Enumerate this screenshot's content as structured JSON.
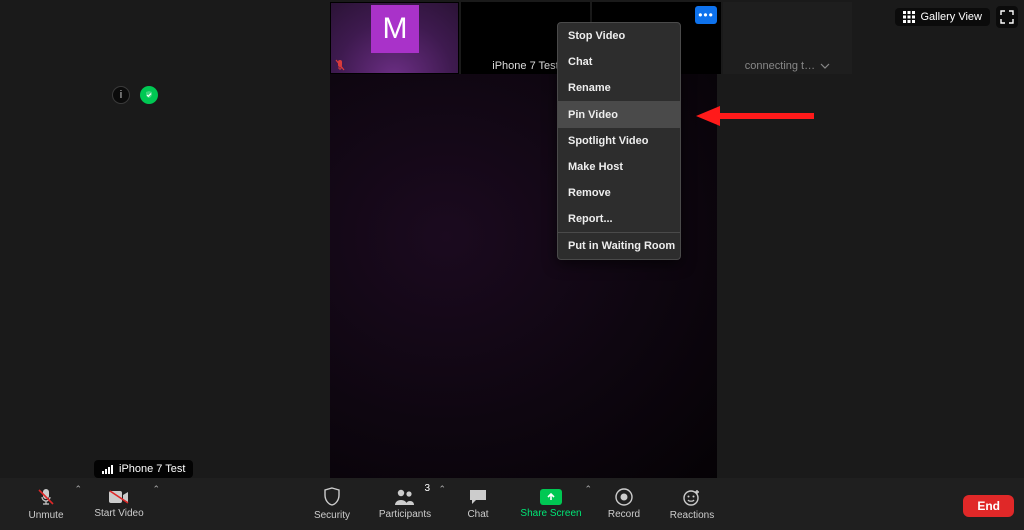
{
  "thumbnails": {
    "p1": {
      "avatar_letter": "M",
      "muted": true
    },
    "p2": {
      "label": "iPhone 7 Test"
    },
    "p3": {
      "has_more_menu": true
    },
    "p4": {
      "status": "connecting t…"
    }
  },
  "top_right": {
    "gallery_label": "Gallery View"
  },
  "context_menu": {
    "stop_video": "Stop Video",
    "chat": "Chat",
    "rename": "Rename",
    "pin_video": "Pin Video",
    "spotlight_video": "Spotlight Video",
    "make_host": "Make Host",
    "remove": "Remove",
    "report": "Report...",
    "waiting_room": "Put in Waiting Room"
  },
  "tooltip": {
    "label": "iPhone 7 Test"
  },
  "toolbar": {
    "unmute": "Unmute",
    "start_video": "Start Video",
    "security": "Security",
    "participants": "Participants",
    "participants_count": "3",
    "chat": "Chat",
    "share_screen": "Share Screen",
    "record": "Record",
    "reactions": "Reactions",
    "end": "End"
  }
}
